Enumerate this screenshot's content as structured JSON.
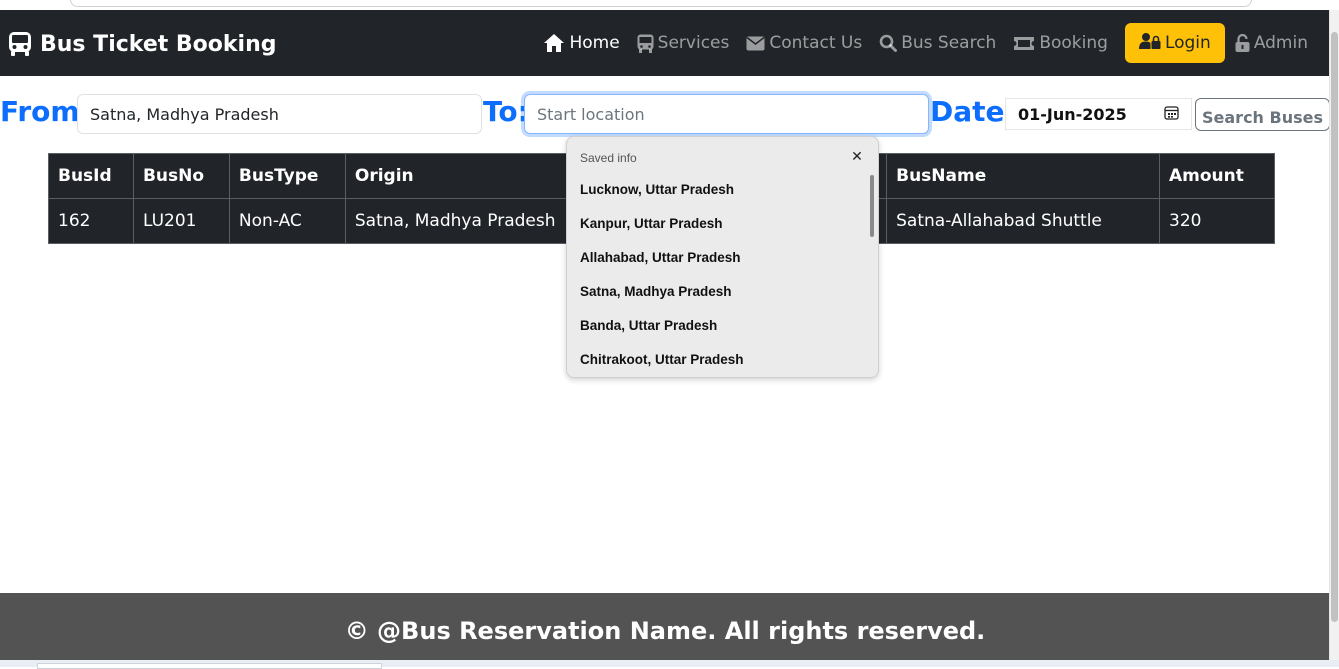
{
  "navbar": {
    "brand": "Bus Ticket Booking",
    "items": [
      {
        "label": "Home",
        "icon": "home-icon",
        "active": true
      },
      {
        "label": "Services",
        "icon": "bus-icon"
      },
      {
        "label": "Contact Us",
        "icon": "envelope-icon"
      },
      {
        "label": "Bus Search",
        "icon": "search-icon"
      },
      {
        "label": "Booking",
        "icon": "ticket-icon"
      }
    ],
    "login": "Login",
    "admin": "Admin",
    "accent": "#ffc107"
  },
  "search": {
    "from_label": "From:",
    "from_value": "Satna, Madhya Pradesh",
    "to_label": "To:",
    "to_placeholder": "Start location",
    "date_label": "Date:",
    "date_value": "01-Jun-2025",
    "button": "Search Buses",
    "label_color": "#0d6efd"
  },
  "table": {
    "headers": [
      "BusId",
      "BusNo",
      "BusType",
      "Origin",
      "",
      "BusName",
      "Amount"
    ],
    "rows": [
      [
        "162",
        "LU201",
        "Non-AC",
        "Satna, Madhya Pradesh",
        "",
        "Satna-Allahabad Shuttle",
        "320"
      ]
    ]
  },
  "autofill": {
    "title": "Saved info",
    "items": [
      "Lucknow, Uttar Pradesh",
      "Kanpur, Uttar Pradesh",
      "Allahabad, Uttar Pradesh",
      "Satna, Madhya Pradesh",
      "Banda, Uttar Pradesh",
      "Chitrakoot, Uttar Pradesh"
    ]
  },
  "footer": {
    "text": "© @Bus Reservation Name. All rights reserved."
  }
}
